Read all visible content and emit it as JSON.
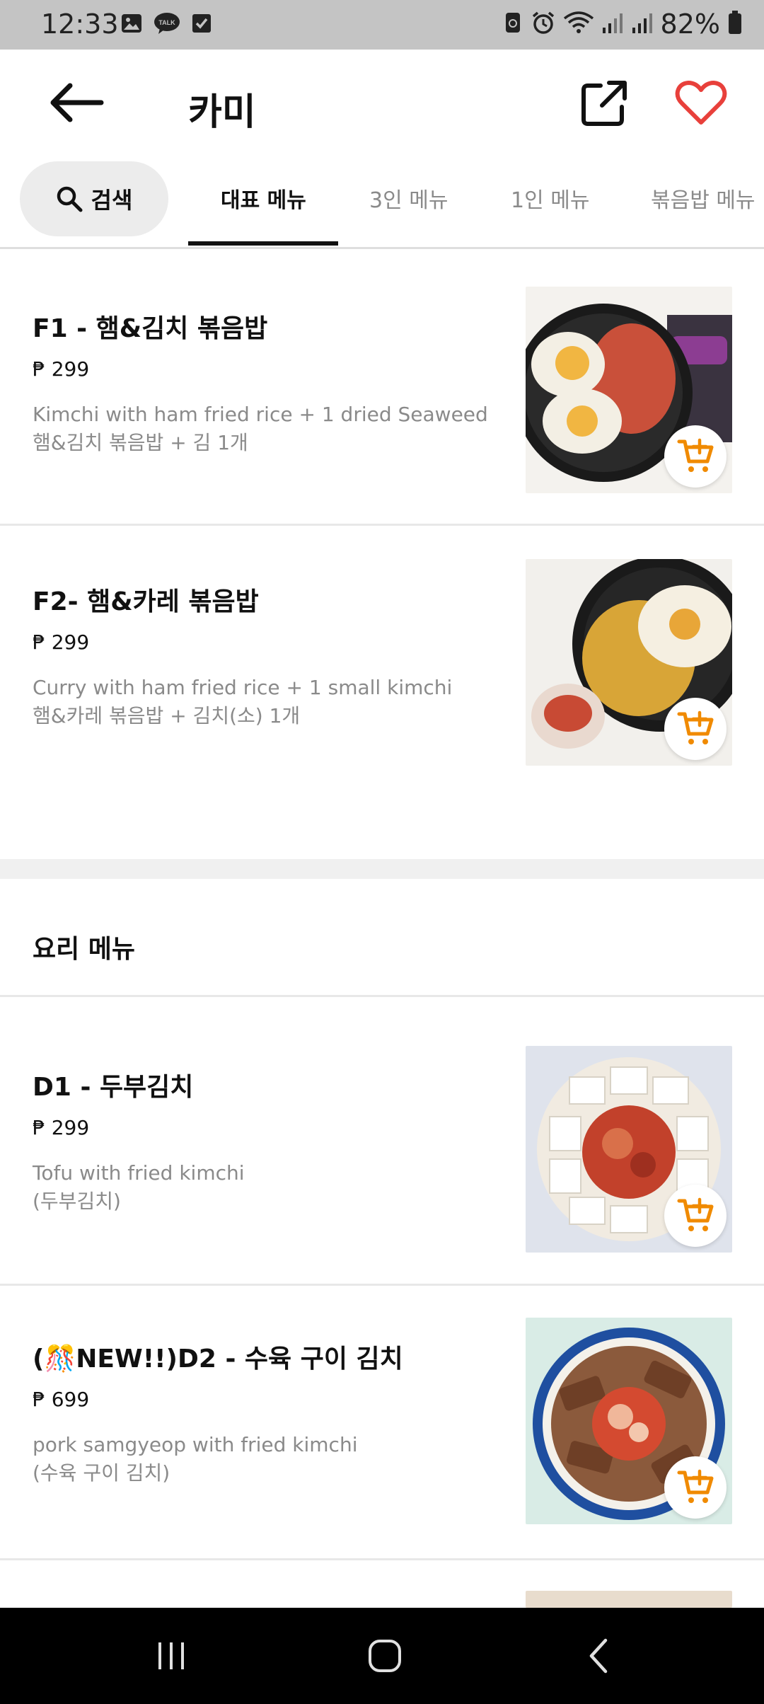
{
  "status_bar": {
    "time": "12:33",
    "battery": "82%",
    "left_icons": [
      "gallery-icon",
      "kakaotalk-icon",
      "checkbox-icon"
    ],
    "right_icons": [
      "recycle-icon",
      "alarm-icon",
      "wifi-icon",
      "signal-icon",
      "signal-icon",
      "battery-icon"
    ]
  },
  "header": {
    "title": "카미",
    "back_icon": "arrow-left-icon",
    "share_icon": "share-icon",
    "favorite_icon": "heart-icon",
    "favorite_color": "#e8403b"
  },
  "tabs": {
    "search_label": "검색",
    "items": [
      {
        "label": "대표 메뉴",
        "active": true
      },
      {
        "label": "3인 메뉴",
        "active": false
      },
      {
        "label": "1인 메뉴",
        "active": false
      },
      {
        "label": "볶음밥 메뉴",
        "active": false
      }
    ]
  },
  "menu": {
    "featured": [
      {
        "name": "F1 - 햄&김치 볶음밥",
        "price": "₱ 299",
        "desc_en": "Kimchi with ham fried rice + 1 dried Seaweed",
        "desc_ko": "햄&김치 볶음밥 + 김 1개",
        "image": "kimchi-fried-rice-photo"
      },
      {
        "name": "F2- 햄&카레 볶음밥",
        "price": "₱ 299",
        "desc_en": "Curry with ham fried rice + 1 small kimchi",
        "desc_ko": "햄&카레 볶음밥 + 김치(소) 1개",
        "image": "curry-fried-rice-photo"
      }
    ],
    "section_title": "요리 메뉴",
    "dishes": [
      {
        "name": "D1 - 두부김치",
        "price": "₱ 299",
        "desc_en": "Tofu with fried kimchi",
        "desc_ko": "(두부김치)",
        "image": "tofu-kimchi-photo"
      },
      {
        "name": "(🎊NEW!!)D2 - 수육 구이 김치",
        "price": "₱ 699",
        "desc_en": "pork samgyeop with fried kimchi",
        "desc_ko": "(수육 구이 김치)",
        "image": "pork-kimchi-photo"
      }
    ]
  },
  "colors": {
    "accent": "#f08a00",
    "cart_icon": "add-to-cart-icon"
  },
  "nav": {
    "recent_icon": "recent-apps-icon",
    "home_icon": "home-icon",
    "back_icon": "back-icon"
  }
}
